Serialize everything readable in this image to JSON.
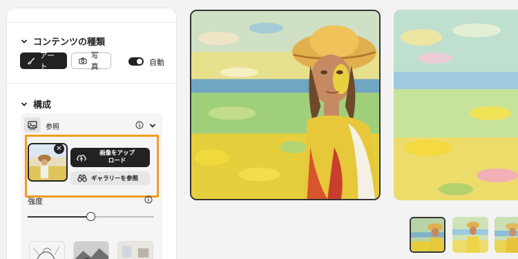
{
  "sidebar": {
    "content_type": {
      "title": "コンテンツの種類",
      "art_label": "アート",
      "photo_label": "写真",
      "auto_label": "自動",
      "auto_enabled": true
    },
    "composition": {
      "title": "構成",
      "reference_label": "参照",
      "upload_label_line1": "画像をアップ",
      "upload_label_line2": "ロード",
      "gallery_label": "ギャラリーを参照",
      "strength_label": "強度",
      "strength_value": 0.5
    }
  },
  "icons": {
    "chevron": "chevron-down-icon",
    "art": "brush-icon",
    "photo": "camera-icon",
    "reference": "image-reference-icon",
    "info": "info-icon",
    "upload": "cloud-upload-icon",
    "gallery": "binoculars-icon",
    "remove": "close-icon"
  },
  "colors": {
    "highlight": "#f29b1f",
    "dark": "#222222"
  }
}
